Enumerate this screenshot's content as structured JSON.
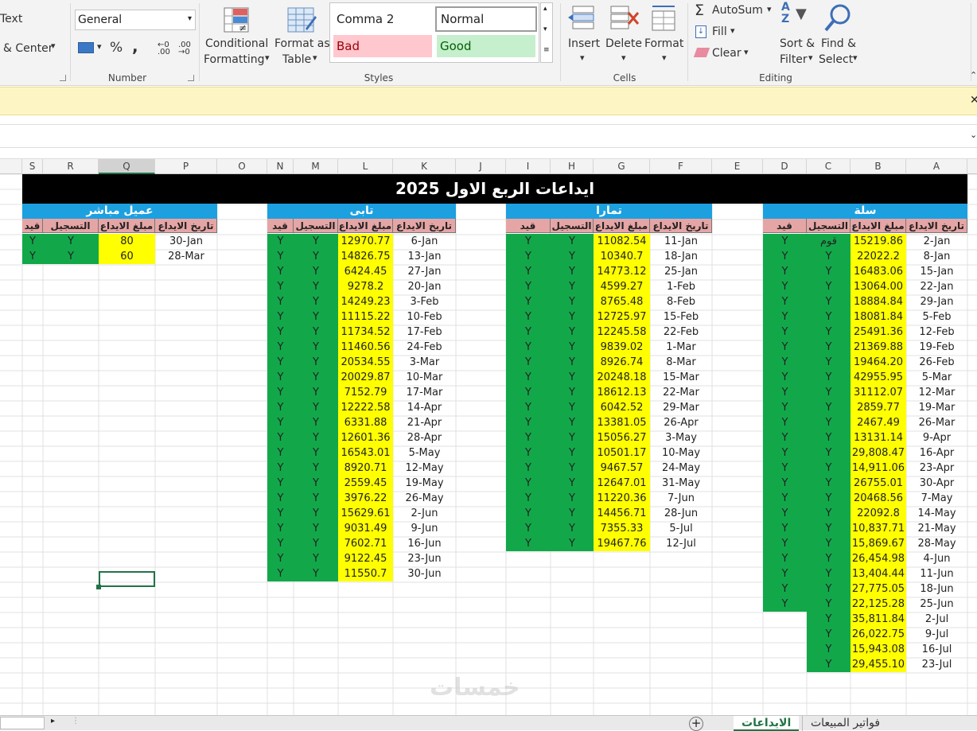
{
  "ribbon": {
    "wrap_text": "Text",
    "merge_center": "& Center",
    "number_format": "General",
    "percent": "%",
    "comma": ",",
    "group_number": "Number",
    "conditional": "Conditional",
    "formatting": "Formatting",
    "format_as": "Format as",
    "table": "Table",
    "styles": {
      "comma2": "Comma 2",
      "normal": "Normal",
      "bad": "Bad",
      "good": "Good"
    },
    "group_styles": "Styles",
    "insert": "Insert",
    "delete": "Delete",
    "format": "Format",
    "group_cells": "Cells",
    "autosum": "AutoSum",
    "fill": "Fill",
    "clear": "Clear",
    "sort1": "Sort &",
    "sort2": "Filter",
    "find1": "Find &",
    "find2": "Select",
    "group_editing": "Editing"
  },
  "column_headers": [
    "S",
    "R",
    "Q",
    "P",
    "O",
    "N",
    "M",
    "L",
    "K",
    "J",
    "I",
    "H",
    "G",
    "F",
    "E",
    "D",
    "C",
    "B",
    "A"
  ],
  "title": "ايداعات الربع الاول 2025",
  "header_row": [
    "قيد",
    "التسجيل",
    "مبلغ الايداع",
    "تاريخ الايداع"
  ],
  "sections": [
    {
      "name": "سلة",
      "rows": [
        [
          "Y",
          "قوم",
          "15219.86",
          "2-Jan"
        ],
        [
          "Y",
          "Y",
          "22022.2",
          "8-Jan"
        ],
        [
          "Y",
          "Y",
          "16483.06",
          "15-Jan"
        ],
        [
          "Y",
          "Y",
          "13064.00",
          "22-Jan"
        ],
        [
          "Y",
          "Y",
          "18884.84",
          "29-Jan"
        ],
        [
          "Y",
          "Y",
          "18081.84",
          "5-Feb"
        ],
        [
          "Y",
          "Y",
          "25491.36",
          "12-Feb"
        ],
        [
          "Y",
          "Y",
          "21369.88",
          "19-Feb"
        ],
        [
          "Y",
          "Y",
          "19464.20",
          "26-Feb"
        ],
        [
          "Y",
          "Y",
          "42955.95",
          "5-Mar"
        ],
        [
          "Y",
          "Y",
          "31112.07",
          "12-Mar"
        ],
        [
          "Y",
          "Y",
          "2859.77",
          "19-Mar"
        ],
        [
          "Y",
          "Y",
          "2467.49",
          "26-Mar"
        ],
        [
          "Y",
          "Y",
          "13131.14",
          "9-Apr"
        ],
        [
          "Y",
          "Y",
          "29,808.47",
          "16-Apr"
        ],
        [
          "Y",
          "Y",
          "14,911.06",
          "23-Apr"
        ],
        [
          "Y",
          "Y",
          "26755.01",
          "30-Apr"
        ],
        [
          "Y",
          "Y",
          "20468.56",
          "7-May"
        ],
        [
          "Y",
          "Y",
          "22092.8",
          "14-May"
        ],
        [
          "Y",
          "Y",
          "10,837.71",
          "21-May"
        ],
        [
          "Y",
          "Y",
          "15,869.67",
          "28-May"
        ],
        [
          "Y",
          "Y",
          "26,454.98",
          "4-Jun"
        ],
        [
          "Y",
          "Y",
          "13,404.44",
          "11-Jun"
        ],
        [
          "Y",
          "Y",
          "27,775.05",
          "18-Jun"
        ],
        [
          "Y",
          "Y",
          "22,125.28",
          "25-Jun"
        ],
        [
          "",
          "Y",
          "35,811.84",
          "2-Jul"
        ],
        [
          "",
          "Y",
          "26,022.75",
          "9-Jul"
        ],
        [
          "",
          "Y",
          "15,943.08",
          "16-Jul"
        ],
        [
          "",
          "Y",
          "29,455.10",
          "23-Jul"
        ]
      ]
    },
    {
      "name": "تمارا",
      "rows": [
        [
          "Y",
          "Y",
          "11082.54",
          "11-Jan"
        ],
        [
          "Y",
          "Y",
          "10340.7",
          "18-Jan"
        ],
        [
          "Y",
          "Y",
          "14773.12",
          "25-Jan"
        ],
        [
          "Y",
          "Y",
          "4599.27",
          "1-Feb"
        ],
        [
          "Y",
          "Y",
          "8765.48",
          "8-Feb"
        ],
        [
          "Y",
          "Y",
          "12725.97",
          "15-Feb"
        ],
        [
          "Y",
          "Y",
          "12245.58",
          "22-Feb"
        ],
        [
          "Y",
          "Y",
          "9839.02",
          "1-Mar"
        ],
        [
          "Y",
          "Y",
          "8926.74",
          "8-Mar"
        ],
        [
          "Y",
          "Y",
          "20248.18",
          "15-Mar"
        ],
        [
          "Y",
          "Y",
          "18612.13",
          "22-Mar"
        ],
        [
          "Y",
          "Y",
          "6042.52",
          "29-Mar"
        ],
        [
          "Y",
          "Y",
          "13381.05",
          "26-Apr"
        ],
        [
          "Y",
          "Y",
          "15056.27",
          "3-May"
        ],
        [
          "Y",
          "Y",
          "10501.17",
          "10-May"
        ],
        [
          "Y",
          "Y",
          "9467.57",
          "24-May"
        ],
        [
          "Y",
          "Y",
          "12647.01",
          "31-May"
        ],
        [
          "Y",
          "Y",
          "11220.36",
          "7-Jun"
        ],
        [
          "Y",
          "Y",
          "14456.71",
          "28-Jun"
        ],
        [
          "Y",
          "Y",
          "7355.33",
          "5-Jul"
        ],
        [
          "Y",
          "Y",
          "19467.76",
          "12-Jul"
        ]
      ]
    },
    {
      "name": "تابى",
      "rows": [
        [
          "Y",
          "Y",
          "12970.77",
          "6-Jan"
        ],
        [
          "Y",
          "Y",
          "14826.75",
          "13-Jan"
        ],
        [
          "Y",
          "Y",
          "6424.45",
          "27-Jan"
        ],
        [
          "Y",
          "Y",
          "9278.2",
          "20-Jan"
        ],
        [
          "Y",
          "Y",
          "14249.23",
          "3-Feb"
        ],
        [
          "Y",
          "Y",
          "11115.22",
          "10-Feb"
        ],
        [
          "Y",
          "Y",
          "11734.52",
          "17-Feb"
        ],
        [
          "Y",
          "Y",
          "11460.56",
          "24-Feb"
        ],
        [
          "Y",
          "Y",
          "20534.55",
          "3-Mar"
        ],
        [
          "Y",
          "Y",
          "20029.87",
          "10-Mar"
        ],
        [
          "Y",
          "Y",
          "7152.79",
          "17-Mar"
        ],
        [
          "Y",
          "Y",
          "12222.58",
          "14-Apr"
        ],
        [
          "Y",
          "Y",
          "6331.88",
          "21-Apr"
        ],
        [
          "Y",
          "Y",
          "12601.36",
          "28-Apr"
        ],
        [
          "Y",
          "Y",
          "16543.01",
          "5-May"
        ],
        [
          "Y",
          "Y",
          "8920.71",
          "12-May"
        ],
        [
          "Y",
          "Y",
          "2559.45",
          "19-May"
        ],
        [
          "Y",
          "Y",
          "3976.22",
          "26-May"
        ],
        [
          "Y",
          "Y",
          "15629.61",
          "2-Jun"
        ],
        [
          "Y",
          "Y",
          "9031.49",
          "9-Jun"
        ],
        [
          "Y",
          "Y",
          "7602.71",
          "16-Jun"
        ],
        [
          "Y",
          "Y",
          "9122.45",
          "23-Jun"
        ],
        [
          "Y",
          "Y",
          "11550.7",
          "30-Jun"
        ]
      ]
    },
    {
      "name": "عميل مباشر",
      "rows": [
        [
          "Y",
          "Y",
          "80",
          "30-Jan"
        ],
        [
          "Y",
          "Y",
          "60",
          "28-Mar"
        ]
      ]
    }
  ],
  "sheet_tabs": [
    "الايداعات",
    "فواتير المبيعات"
  ],
  "watermark": "خمسات",
  "colors": {
    "black_header": "#000000",
    "section_blue": "#1ca0e0",
    "header_pink": "#e6a5a5",
    "green": "#12a84a",
    "yellow": "#ffff00"
  }
}
